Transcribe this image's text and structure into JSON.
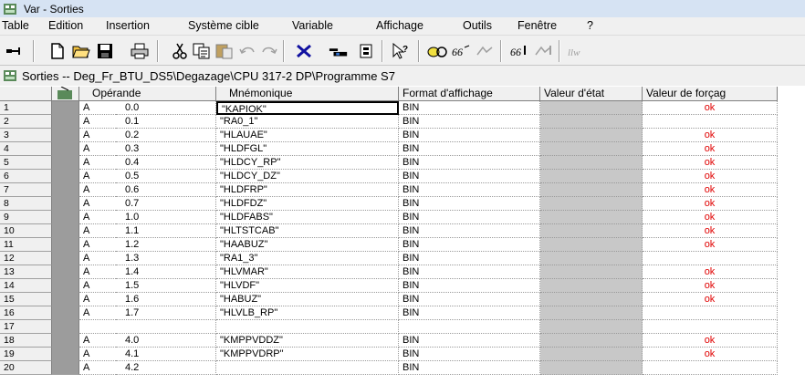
{
  "window": {
    "title": "Var - Sorties"
  },
  "menu": [
    "Table",
    "Edition",
    "Insertion",
    "Système cible",
    "Variable",
    "Affichage",
    "Outils",
    "Fenêtre",
    "?"
  ],
  "subwindow": {
    "title": "Sorties -- Deg_Fr_BTU_DS5\\Degazage\\CPU 317-2 DP\\Programme S7"
  },
  "columns": {
    "operande": "Opérande",
    "mnemonique": "Mnémonique",
    "format": "Format d'affichage",
    "etat": "Valeur d'état",
    "forcage": "Valeur de forçag"
  },
  "rows": [
    {
      "num": "1",
      "area": "A",
      "addr": "0.0",
      "symbol": "\"KAPIOK\"",
      "format": "BIN",
      "force": "ok"
    },
    {
      "num": "2",
      "area": "A",
      "addr": "0.1",
      "symbol": "\"RA0_1\"",
      "format": "BIN",
      "force": ""
    },
    {
      "num": "3",
      "area": "A",
      "addr": "0.2",
      "symbol": "\"HLAUAE\"",
      "format": "BIN",
      "force": "ok"
    },
    {
      "num": "4",
      "area": "A",
      "addr": "0.3",
      "symbol": "\"HLDFGL\"",
      "format": "BIN",
      "force": "ok"
    },
    {
      "num": "5",
      "area": "A",
      "addr": "0.4",
      "symbol": "\"HLDCY_RP\"",
      "format": "BIN",
      "force": "ok"
    },
    {
      "num": "6",
      "area": "A",
      "addr": "0.5",
      "symbol": "\"HLDCY_DZ\"",
      "format": "BIN",
      "force": "ok"
    },
    {
      "num": "7",
      "area": "A",
      "addr": "0.6",
      "symbol": "\"HLDFRP\"",
      "format": "BIN",
      "force": "ok"
    },
    {
      "num": "8",
      "area": "A",
      "addr": "0.7",
      "symbol": "\"HLDFDZ\"",
      "format": "BIN",
      "force": "ok"
    },
    {
      "num": "9",
      "area": "A",
      "addr": "1.0",
      "symbol": "\"HLDFABS\"",
      "format": "BIN",
      "force": "ok"
    },
    {
      "num": "10",
      "area": "A",
      "addr": "1.1",
      "symbol": "\"HLTSTCAB\"",
      "format": "BIN",
      "force": "ok"
    },
    {
      "num": "11",
      "area": "A",
      "addr": "1.2",
      "symbol": "\"HAABUZ\"",
      "format": "BIN",
      "force": "ok"
    },
    {
      "num": "12",
      "area": "A",
      "addr": "1.3",
      "symbol": "\"RA1_3\"",
      "format": "BIN",
      "force": ""
    },
    {
      "num": "13",
      "area": "A",
      "addr": "1.4",
      "symbol": "\"HLVMAR\"",
      "format": "BIN",
      "force": "ok"
    },
    {
      "num": "14",
      "area": "A",
      "addr": "1.5",
      "symbol": "\"HLVDF\"",
      "format": "BIN",
      "force": "ok"
    },
    {
      "num": "15",
      "area": "A",
      "addr": "1.6",
      "symbol": "\"HABUZ\"",
      "format": "BIN",
      "force": "ok"
    },
    {
      "num": "16",
      "area": "A",
      "addr": "1.7",
      "symbol": "\"HLVLB_RP\"",
      "format": "BIN",
      "force": ""
    },
    {
      "num": "17",
      "area": "",
      "addr": "",
      "symbol": "",
      "format": "",
      "force": ""
    },
    {
      "num": "18",
      "area": "A",
      "addr": "4.0",
      "symbol": "\"KMPPVDDZ\"",
      "format": "BIN",
      "force": "ok"
    },
    {
      "num": "19",
      "area": "A",
      "addr": "4.1",
      "symbol": "\"KMPPVDRP\"",
      "format": "BIN",
      "force": "ok"
    },
    {
      "num": "20",
      "area": "A",
      "addr": "4.2",
      "symbol": "",
      "format": "BIN",
      "force": ""
    }
  ],
  "colors": {
    "force_ok": "#e00000",
    "status_column": "#c8c8c8",
    "title_bar": "#d6e3f3"
  }
}
